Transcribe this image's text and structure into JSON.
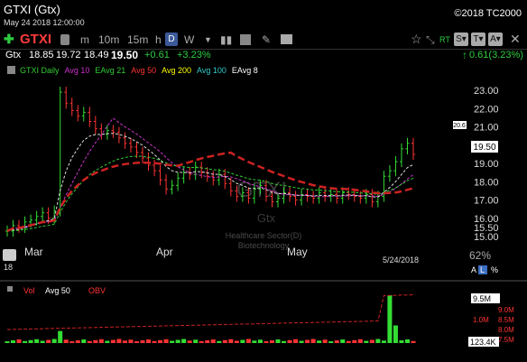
{
  "header": {
    "title": "GTXI (Gtx)",
    "date": "May 24 2018 12:00:00",
    "copyright": "©2018 TC2000"
  },
  "toolbar": {
    "plus": "✚",
    "symbol": "GTXI",
    "timeframes": [
      "m",
      "10m",
      "15m",
      "h",
      "D",
      "W"
    ],
    "active_timeframe": "D",
    "rt_label": "RT",
    "btn_st": "S▾",
    "btn_t": "T▾",
    "btn_a": "A▾"
  },
  "quote": {
    "name": "Gtx",
    "open": "18.85",
    "high": "19.72",
    "low": "18.49",
    "last": "19.50",
    "change": "+0.61",
    "pct": "+3.23%",
    "right_change": "0.61(3.23%)"
  },
  "legend": {
    "items": [
      {
        "label": "GTXI Daily",
        "color": "#33cc33"
      },
      {
        "label": "Avg 10",
        "color": "#cc33cc"
      },
      {
        "label": "EAvg 21",
        "color": "#33cc33"
      },
      {
        "label": "Avg 50",
        "color": "#ff3333"
      },
      {
        "label": "Avg 200",
        "color": "#ffff00"
      },
      {
        "label": "Avg 100",
        "color": "#33cccc"
      },
      {
        "label": "EAvg 8",
        "color": "#ffffff"
      }
    ]
  },
  "watermark": {
    "symbol": "GTXI",
    "name": "Gtx",
    "sector": "Healthcare Sector(D)",
    "industry": "Biotechnology"
  },
  "price_axis": {
    "ticks": [
      "23.00",
      "22.00",
      "21.00",
      "20.00",
      "19.00",
      "18.00",
      "17.00",
      "16.00",
      "15.50",
      "15.00"
    ],
    "last_label": "19.50",
    "upper_label": "20.6",
    "zoom": "62%"
  },
  "time_axis": {
    "months": [
      "Mar",
      "Apr",
      "May"
    ],
    "end_date": "5/24/2018",
    "corner": "18"
  },
  "scale_buttons": {
    "a": "A",
    "l": "L",
    "pct": "%"
  },
  "volume": {
    "legend": [
      {
        "label": "Vol",
        "color": "#ff3333"
      },
      {
        "label": "Avg 50",
        "color": "#ffffff"
      },
      {
        "label": "OBV",
        "color": "#ff3333"
      }
    ],
    "vol_ticks": [
      "9.5M",
      "123.4K"
    ],
    "obv_ticks": [
      "9.0M",
      "8.5M",
      "8.0M",
      "7.5M"
    ],
    "avg_label": "1.0M"
  },
  "chart_data": {
    "type": "candlestick",
    "x_labels": [
      "Mar",
      "Apr",
      "May"
    ],
    "ylim": [
      15,
      23.5
    ],
    "last_price": 19.5,
    "closes": [
      15.3,
      15.6,
      15.5,
      15.8,
      15.9,
      16.1,
      16.3,
      16.0,
      16.4,
      22.9,
      22.3,
      21.9,
      21.6,
      21.8,
      21.3,
      20.9,
      20.6,
      20.8,
      20.7,
      20.4,
      20.1,
      19.9,
      19.6,
      19.3,
      18.9,
      18.6,
      18.1,
      17.6,
      17.8,
      18.2,
      18.5,
      18.4,
      18.8,
      18.5,
      18.3,
      18.1,
      18.4,
      17.9,
      17.5,
      17.2,
      17.4,
      17.1,
      17.6,
      17.8,
      17.2,
      16.9,
      17.1,
      17.4,
      17.2,
      17.0,
      17.3,
      17.2,
      17.1,
      17.4,
      17.2,
      17.3,
      17.1,
      17.4,
      17.3,
      17.2,
      17.1,
      17.3,
      16.9,
      17.2,
      18.3,
      18.6,
      19.1,
      19.8,
      20.1,
      19.5
    ],
    "volume_spikes": [
      {
        "bar": 9,
        "value": 2.4
      },
      {
        "bar": 65,
        "value": 9.5
      },
      {
        "bar": 66,
        "value": 3.5
      }
    ],
    "volume_ylim": [
      0,
      9.5
    ],
    "volume_unit": "M"
  }
}
